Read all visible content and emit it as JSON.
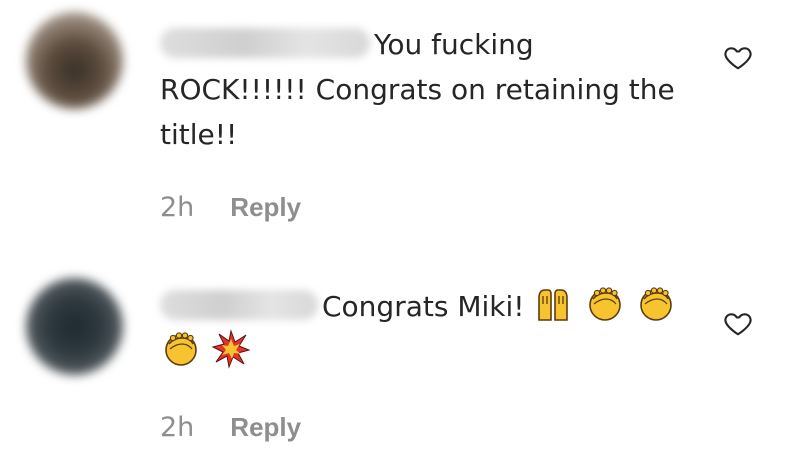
{
  "comments": [
    {
      "text": "You fucking ROCK!!!!!! Congrats on retaining the title!!",
      "time": "2h",
      "reply_label": "Reply",
      "avatar_icon": "blurred-avatar",
      "like_icon": "heart-outline-icon"
    },
    {
      "text": "Congrats Miki!",
      "emojis": [
        "raising-hands-emoji",
        "clapping-hands-emoji",
        "clapping-hands-emoji",
        "clapping-hands-emoji",
        "collision-emoji"
      ],
      "time": "2h",
      "reply_label": "Reply",
      "avatar_icon": "blurred-avatar",
      "like_icon": "heart-outline-icon"
    }
  ],
  "colors": {
    "text": "#262626",
    "meta": "#8e8e8e",
    "emoji_yellow": "#f7c42f",
    "collision_red": "#e4332b"
  }
}
